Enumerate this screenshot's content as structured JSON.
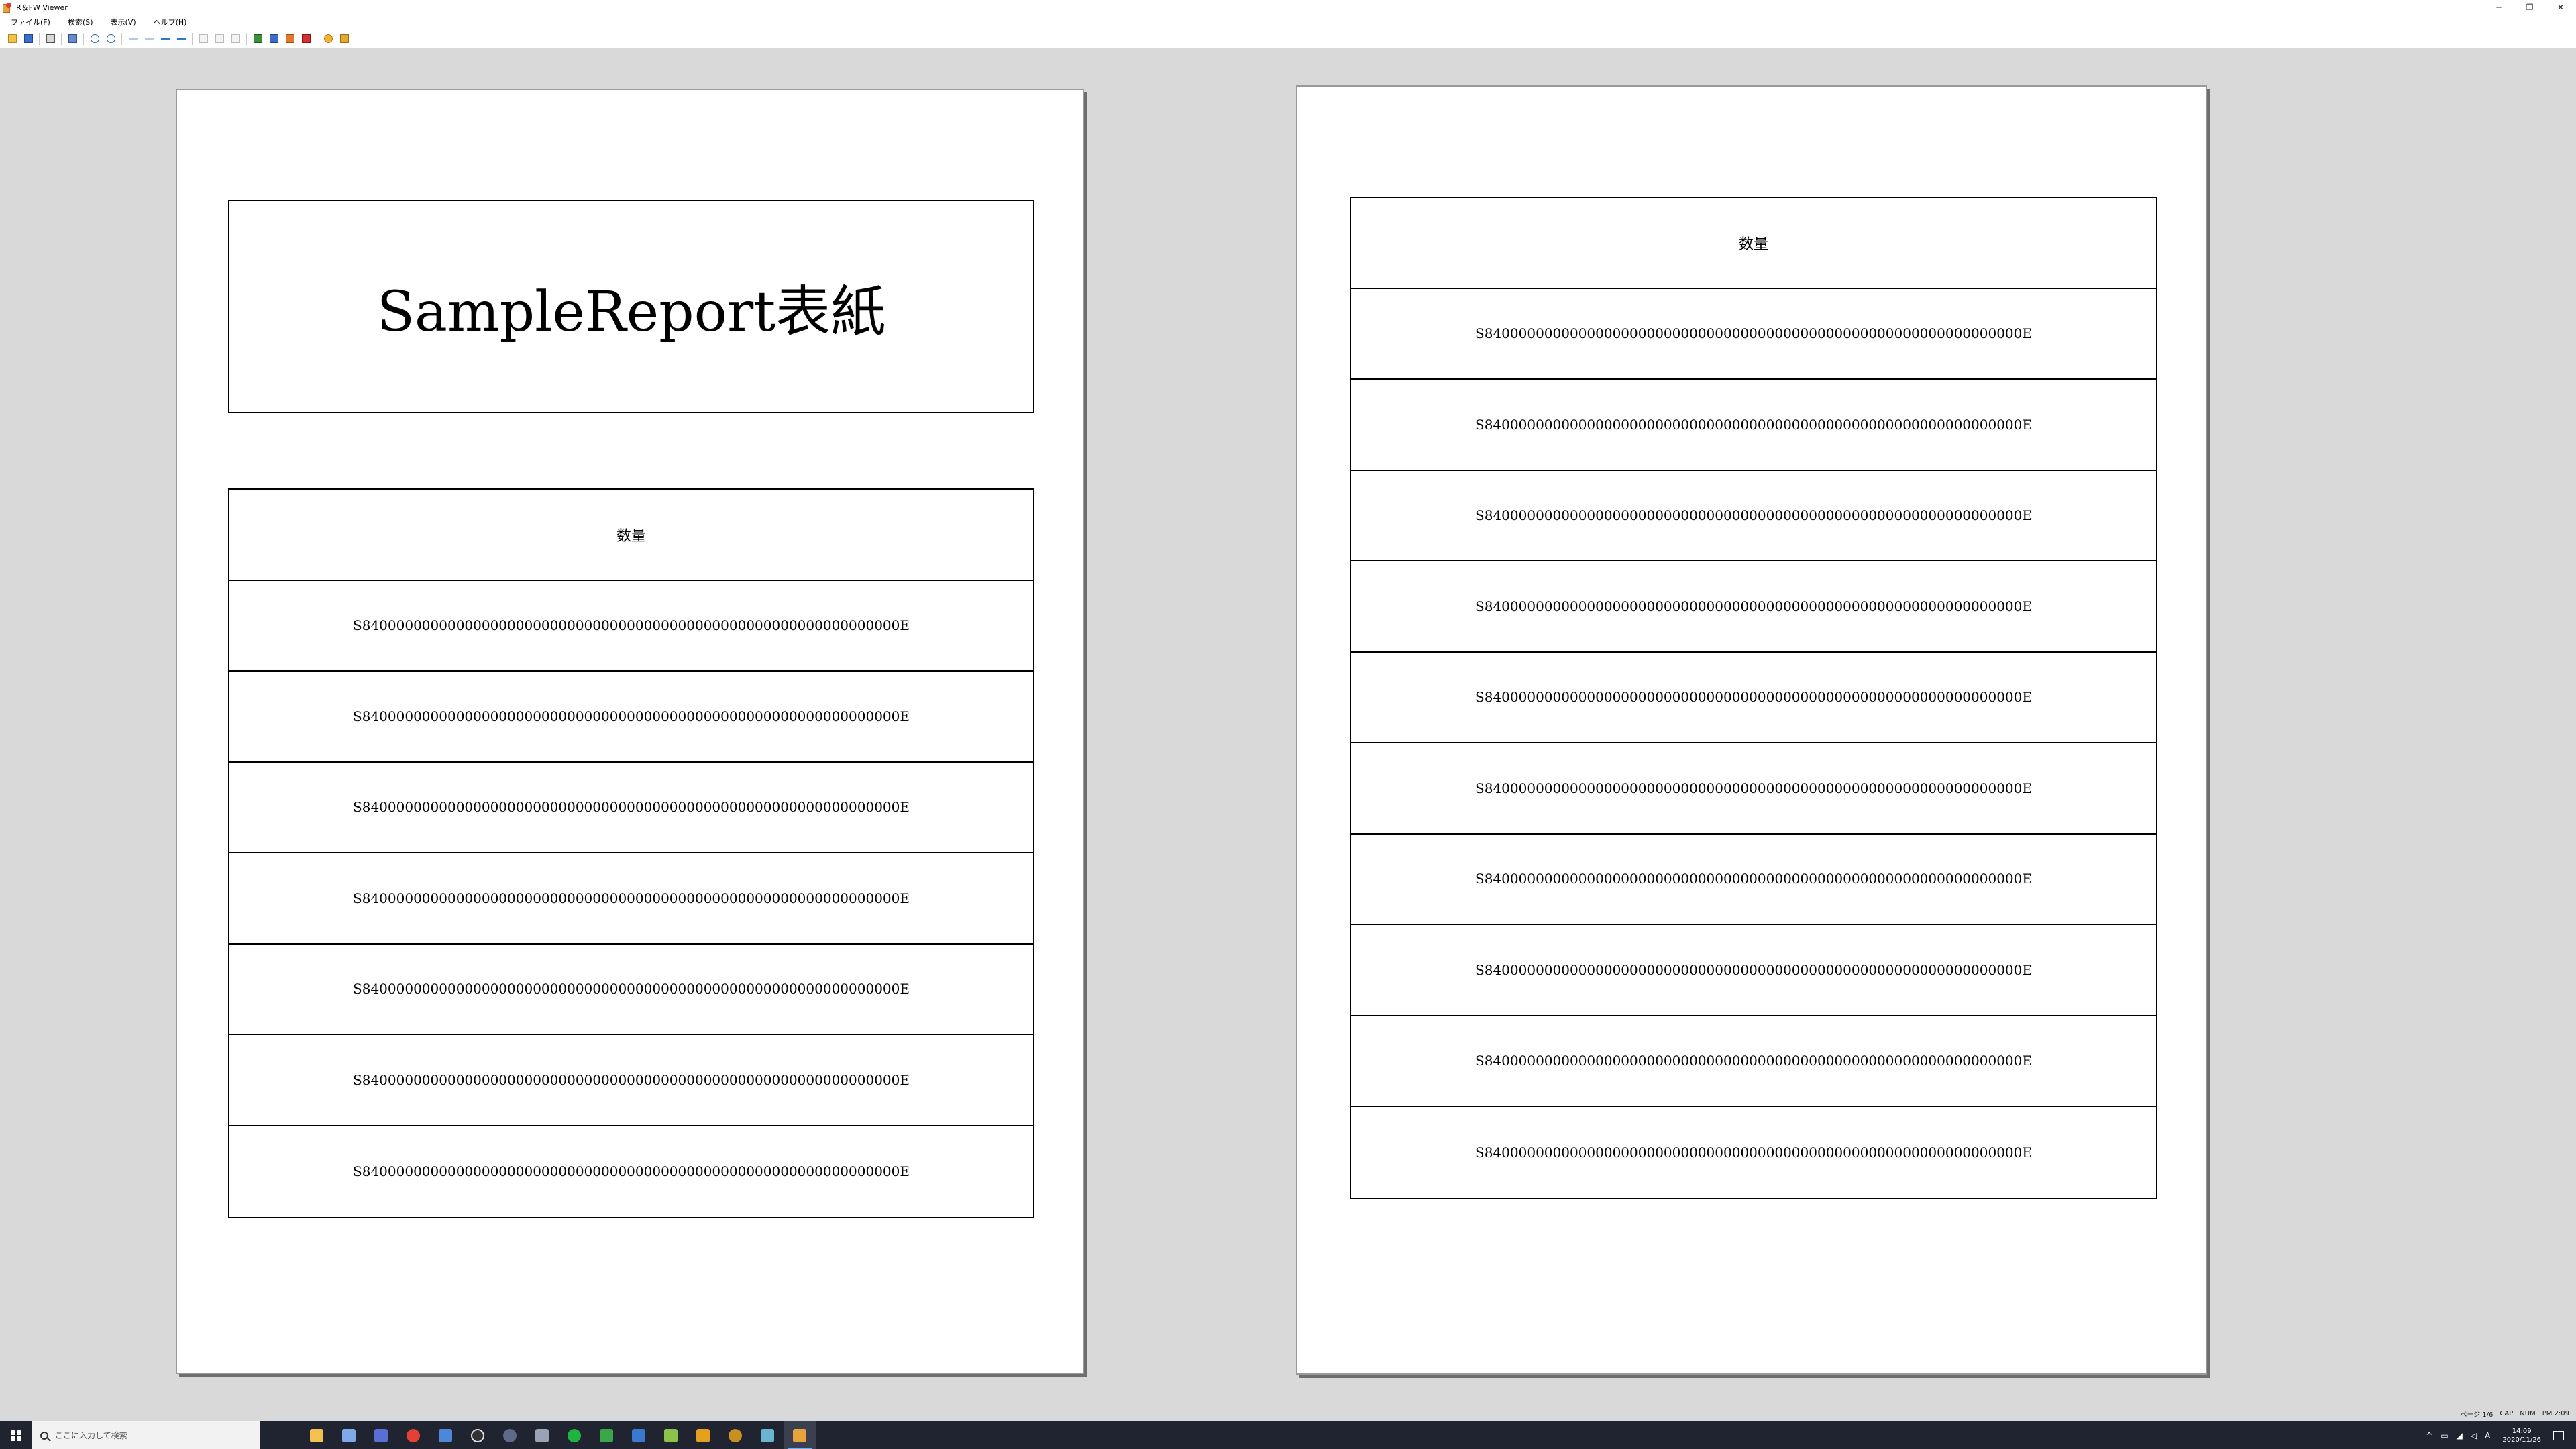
{
  "window": {
    "title": "R＆FW Viewer",
    "minimize": "─",
    "maximize": "❐",
    "close": "✕"
  },
  "menu": {
    "items": [
      "ファイル(F)",
      "検索(S)",
      "表示(V)",
      "ヘルプ(H)"
    ]
  },
  "toolbar": {
    "icons": [
      "open-icon",
      "save-icon",
      "print-icon",
      "page-layout-icon",
      "zoom-in-icon",
      "zoom-out-icon",
      "first-page-icon",
      "previous-page-icon",
      "next-page-icon",
      "last-page-icon",
      "go-back-icon",
      "go-forward-icon",
      "export-icon",
      "info-icon",
      "exit-icon"
    ]
  },
  "pages": [
    {
      "cover_title": "SampleReport表紙",
      "header": "数量",
      "rows": [
        "S840000000000000000000000000000000000000000000000000000000000000E",
        "S840000000000000000000000000000000000000000000000000000000000000E",
        "S840000000000000000000000000000000000000000000000000000000000000E",
        "S840000000000000000000000000000000000000000000000000000000000000E",
        "S840000000000000000000000000000000000000000000000000000000000000E",
        "S840000000000000000000000000000000000000000000000000000000000000E",
        "S840000000000000000000000000000000000000000000000000000000000000E"
      ]
    },
    {
      "header": "数量",
      "rows": [
        "S840000000000000000000000000000000000000000000000000000000000000E",
        "S840000000000000000000000000000000000000000000000000000000000000E",
        "S840000000000000000000000000000000000000000000000000000000000000E",
        "S840000000000000000000000000000000000000000000000000000000000000E",
        "S840000000000000000000000000000000000000000000000000000000000000E",
        "S840000000000000000000000000000000000000000000000000000000000000E",
        "S840000000000000000000000000000000000000000000000000000000000000E",
        "S840000000000000000000000000000000000000000000000000000000000000E",
        "S840000000000000000000000000000000000000000000000000000000000000E",
        "S840000000000000000000000000000000000000000000000000000000000000E"
      ]
    }
  ],
  "statusbar": {
    "page": "ページ 1/6",
    "caps": "CAP",
    "num": "NUM",
    "time": "PM 2:09"
  },
  "taskbar": {
    "search_placeholder": "ここに入力して検索",
    "clock_time": "14:09",
    "clock_date": "2020/11/26",
    "ime": "A",
    "tray_chevron": "^",
    "colors": {
      "background": "#1f2430",
      "active_indicator": "#6fa8ff"
    }
  }
}
